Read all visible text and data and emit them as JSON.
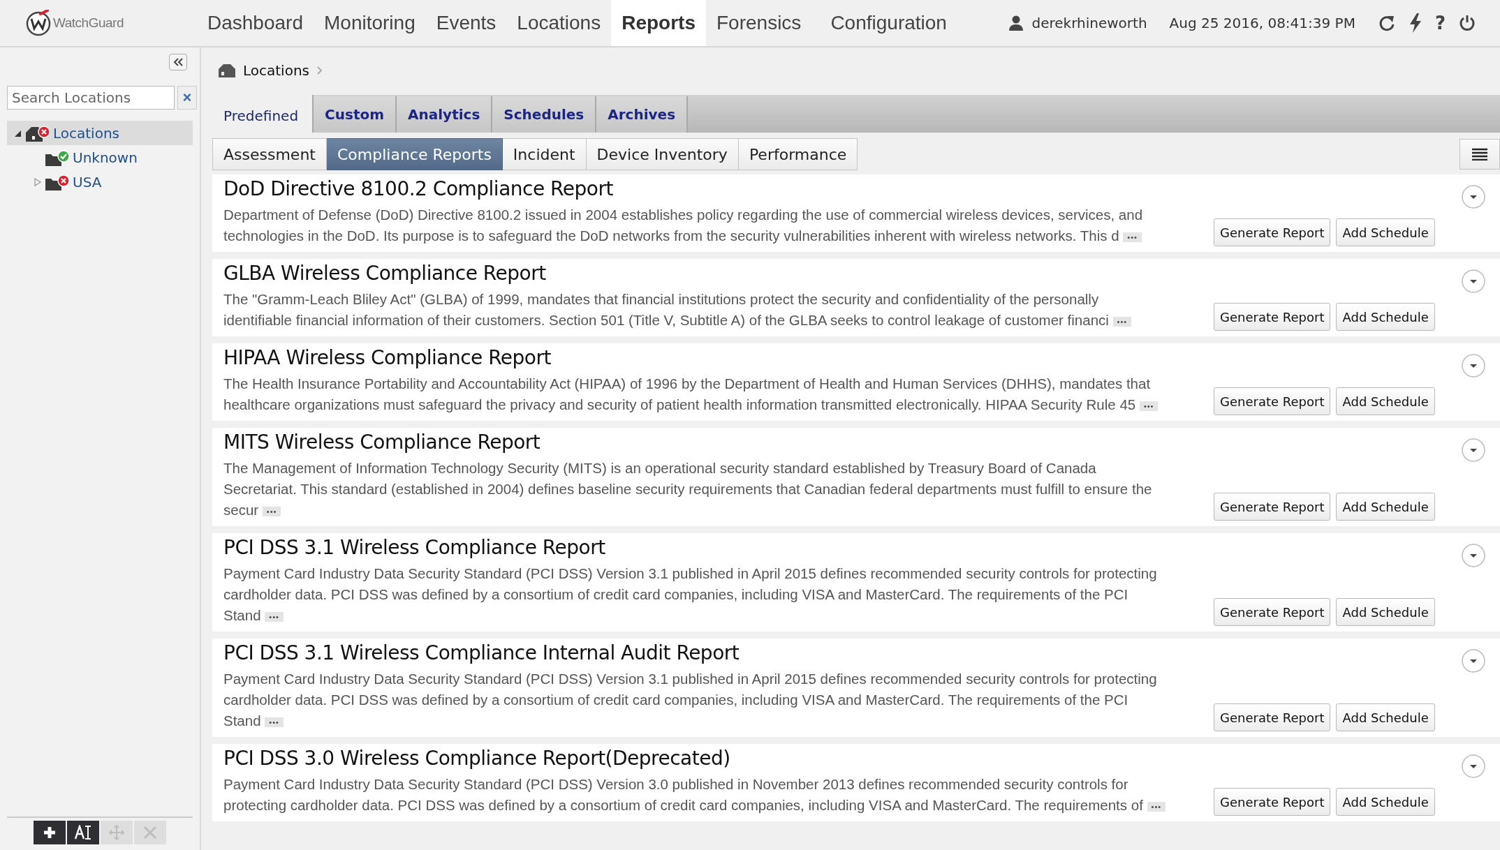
{
  "brand": {
    "name": "WatchGuard"
  },
  "nav": [
    {
      "label": "Dashboard",
      "selected": false
    },
    {
      "label": "Monitoring",
      "selected": false
    },
    {
      "label": "Events",
      "selected": false
    },
    {
      "label": "Locations",
      "selected": false
    },
    {
      "label": "Reports",
      "selected": true
    },
    {
      "label": "Forensics",
      "selected": false
    },
    {
      "label": "Configuration",
      "selected": false
    }
  ],
  "user": "derekrhineworth",
  "datetime": "Aug 25 2016, 08:41:39 PM",
  "help_label": "?",
  "sidebar": {
    "search": {
      "placeholder": "Search Locations"
    },
    "clear_label": "×",
    "tree": [
      {
        "label": "Locations",
        "kind": "error",
        "expanded": true,
        "selected": true,
        "children": [
          {
            "label": "Unknown",
            "kind": "ok",
            "selected": false
          },
          {
            "label": "USA",
            "kind": "error",
            "expanded": false,
            "selected": false
          }
        ]
      }
    ],
    "toolbar": [
      {
        "kind": "add",
        "disabled": false
      },
      {
        "kind": "rename",
        "disabled": false
      },
      {
        "kind": "move",
        "disabled": true
      },
      {
        "kind": "delete",
        "disabled": true
      }
    ]
  },
  "breadcrumb": "Locations",
  "tabs": [
    {
      "label": "Predefined",
      "selected": true
    },
    {
      "label": "Custom",
      "selected": false
    },
    {
      "label": "Analytics",
      "selected": false
    },
    {
      "label": "Schedules",
      "selected": false
    },
    {
      "label": "Archives",
      "selected": false
    }
  ],
  "subtabs": [
    {
      "label": "Assessment",
      "selected": false
    },
    {
      "label": "Compliance Reports",
      "selected": true
    },
    {
      "label": "Incident",
      "selected": false
    },
    {
      "label": "Device Inventory",
      "selected": false
    },
    {
      "label": "Performance",
      "selected": false
    }
  ],
  "more_label": "•••",
  "reports": [
    {
      "title": "DoD Directive 8100.2 Compliance Report",
      "description": "Department of Defense (DoD) Directive 8100.2 issued in 2004 establishes policy regarding the use of commercial wireless devices, services, and technologies in the DoD. Its purpose is to safeguard the DoD networks from the security vulnerabilities inherent with wireless networks. This d",
      "generate": "Generate Report",
      "schedule": "Add Schedule"
    },
    {
      "title": "GLBA Wireless Compliance Report",
      "description": "The \"Gramm-Leach Bliley Act\" (GLBA) of 1999, mandates that financial institutions protect the security and confidentiality of the personally identifiable financial information of their customers. Section 501 (Title V, Subtitle A) of the GLBA seeks to control leakage of customer financi",
      "generate": "Generate Report",
      "schedule": "Add Schedule"
    },
    {
      "title": "HIPAA Wireless Compliance Report",
      "description": "The Health Insurance Portability and Accountability Act (HIPAA) of 1996 by the Department of Health and Human Services (DHHS), mandates that healthcare organizations must safeguard the privacy and security of patient health information transmitted electronically. HIPAA Security Rule 45",
      "generate": "Generate Report",
      "schedule": "Add Schedule"
    },
    {
      "title": "MITS Wireless Compliance Report",
      "description": "The Management of Information Technology Security (MITS) is an operational security standard established by Treasury Board of Canada Secretariat. This standard (established in 2004) defines baseline security requirements that Canadian federal departments must fulfill to ensure the secur",
      "generate": "Generate Report",
      "schedule": "Add Schedule"
    },
    {
      "title": "PCI DSS 3.1 Wireless Compliance Report",
      "description": "Payment Card Industry Data Security Standard (PCI DSS) Version 3.1 published in April 2015 defines recommended security controls for protecting cardholder data. PCI DSS was defined by a consortium of credit card companies, including VISA and MasterCard. The requirements of the PCI Stand",
      "generate": "Generate Report",
      "schedule": "Add Schedule"
    },
    {
      "title": "PCI DSS 3.1 Wireless Compliance Internal Audit Report",
      "description": "Payment Card Industry Data Security Standard (PCI DSS) Version 3.1 published in April 2015 defines recommended security controls for protecting cardholder data. PCI DSS was defined by a consortium of credit card companies, including VISA and MasterCard. The requirements of the PCI Stand",
      "generate": "Generate Report",
      "schedule": "Add Schedule"
    },
    {
      "title": "PCI DSS 3.0 Wireless Compliance Report(Deprecated)",
      "description": "Payment Card Industry Data Security Standard (PCI DSS) Version 3.0 published in November 2013 defines recommended security controls for protecting cardholder data. PCI DSS was defined by a consortium of credit card companies, including VISA and MasterCard. The requirements of",
      "generate": "Generate Report",
      "schedule": "Add Schedule"
    }
  ]
}
